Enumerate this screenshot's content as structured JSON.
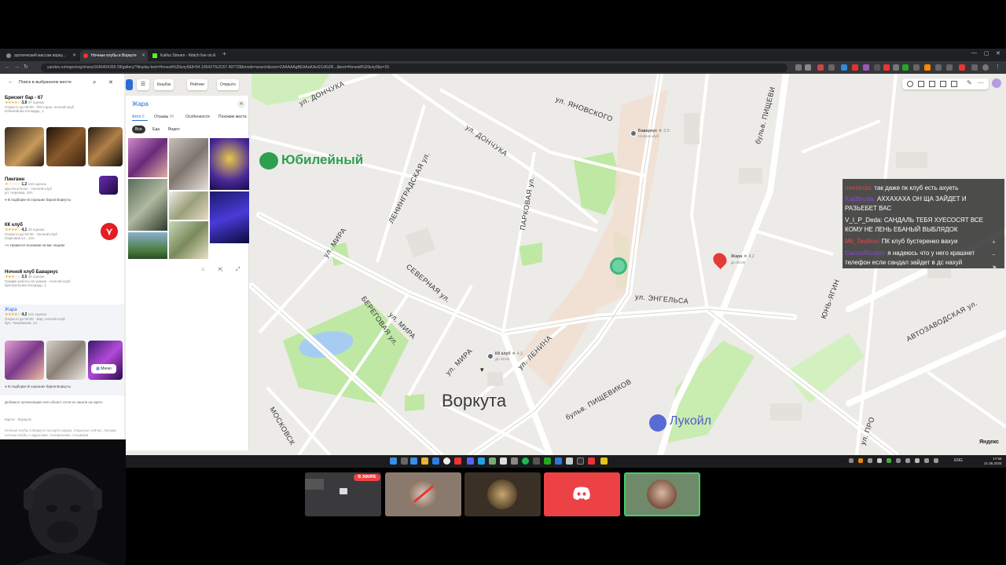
{
  "browser": {
    "tabs": [
      {
        "label": "эротический массаж ворку...",
        "color": "#8a8a8a"
      },
      {
        "label": "Ночные клубы в Воркуте",
        "color": "#e33"
      },
      {
        "label": "Kaifus Stream - Watch live on...",
        "color": "#53fc18"
      }
    ],
    "new_tab": "+",
    "url": "yandex.ru/maps/org/zhara/1646404359 28/gallery/?display-text=Ночной%20клуб&ll=54.105427%2C67.497728&mode=search&sctx=ZAAAAAgBEAAaKAoSCdGZR...&text=Ночной%20клуб&z=15"
  },
  "sidebar": {
    "search_placeholder": "Поиск в выбранном месте",
    "items": [
      {
        "title": "Брискет бар - 67",
        "rating": "3,8",
        "reviews": "37 оценок",
        "sub1": "Открыто до 00:00 · Ресторан, ночной клуб",
        "sub2": "Юбилейная площадь, 1"
      },
      {
        "title": "Пингвин",
        "rating": "1,2",
        "reviews": "116 оценок",
        "sub1": "круглосуточно · Ночной клуб",
        "sub2": "ул. Чернова, 10А",
        "tag": "В подборке В хороших баров Воркуты"
      },
      {
        "title": "КК клуб",
        "rating": "4,1",
        "reviews": "40 оценок",
        "sub1": "Открыто до 02:00 · Ночной клуб",
        "sub2": "Парковая ул., 14А",
        "tag": "Нравится похожим на вас людям"
      },
      {
        "title": "Ночной клуб Баварнус",
        "rating": "3,5",
        "reviews": "40 оценок",
        "sub1": "График работы не указан · Ночной клуб",
        "sub2": "Центральная площадь, 1"
      },
      {
        "title": "Жара",
        "rating": "4,2",
        "reviews": "121 оценок",
        "sub1": "Открыто до 00:00 · Бар, ночной клуб",
        "sub2": "бул. Пищевиков, 14",
        "tag": "В подборке В хороших баров Воркуты",
        "menu": "Меню"
      }
    ],
    "footer_text": "Добавьте организацию или объект, если их нашли на карте.",
    "footer_links": "Карты · Воркута",
    "footer_desc": "Ночные клубы в Воркуте на карте рядом, открытые сейчас. Лучшие ночные клубы с адресами, телефонами, отзывами"
  },
  "filters": {
    "f1": "Кешбэк",
    "f2": "Рейтинг",
    "f3": "Открыто"
  },
  "detail": {
    "title": "Жара",
    "tabs": [
      {
        "label": "Фото",
        "count": "8"
      },
      {
        "label": "Отзывы",
        "count": "96"
      },
      {
        "label": "Особенности",
        "count": ""
      },
      {
        "label": "Похожие места",
        "count": ""
      }
    ],
    "chips": [
      "Все",
      "Еда",
      "Видео"
    ]
  },
  "map": {
    "labels": {
      "donchuka1": "ул. ДОНЧУКА",
      "donchuka2": "ул. ДОНЧУКА",
      "yanovskogo": "ул. ЯНОВСКОГО",
      "pishevikov_top": "бульв. ПИЩЕВИ",
      "leningradskaya": "ЛЕНИНГРАДСКАЯ ул.",
      "parkovaya": "ПАРКОВАЯ ул.",
      "mira1": "ул. МИРА",
      "severnaya": "СЕВЕРНАЯ ул.",
      "beregovaya": "БЕРЕГОВАЯ ул.",
      "mira2": "ул. МИРА",
      "mira3": "ул. МИРА",
      "lenina": "ул. ЛЕНИНА",
      "engelsa": "ул. ЭНГЕЛЬСА",
      "pishevikov": "бульв. ПИЩЕВИКОВ",
      "avtozavodskaya": "АВТОЗАВОДСКАЯ ул.",
      "yunyagin": "ЮНЬ-ЯГИН",
      "moskovsk": "МОСКОВСК",
      "upro": "ул. ПРО",
      "vorkuta": "Воркута",
      "yubileyny": "Юбилейный",
      "lukoil": "Лукойл",
      "yandex": "Яндекс"
    },
    "pois": {
      "bavarus": {
        "name": "Баварнус",
        "rating": "★ 3,5",
        "sub": "Ночной клуб"
      },
      "zhara": {
        "name": "Жара",
        "rating": "★ 4,2",
        "sub": "До 00:00"
      },
      "kk": {
        "name": "КК клуб",
        "rating": "★ 4,1",
        "sub": "До 02:00"
      }
    }
  },
  "chat": {
    "messages": [
      {
        "user": "",
        "text": "",
        "color": "#9a9a9a"
      },
      {
        "user": "neelanda:",
        "text": "так даже пк клуб есть ахуеть",
        "color": "#c34b4b"
      },
      {
        "user": "Kajdbruda:",
        "text": "АХХАХАХА ОН ЩА ЗАЙДЕТ И",
        "color": "#8a4bd8"
      },
      {
        "user": "",
        "text": "РАЗЬЕБЕТ ВАС",
        "color": ""
      },
      {
        "user": "V_I_P_Deda:",
        "text": "САНДАЛЬ ТЕБЯ ХУЕСОСЯТ ВСЕ",
        "color": "#ffffff"
      },
      {
        "user": "",
        "text": "КОМУ НЕ ЛЕНЬ ЕБАНЫЙ ВЫБЛЯДОК",
        "color": ""
      },
      {
        "user": "Mk_Teufilov:",
        "text": "ПК клуб бустеренко вахуи",
        "color": "#e04a4a"
      },
      {
        "user": "CactusRodzin:",
        "text": "я надеюсь что у него крашнет",
        "color": "#8a4bd8"
      },
      {
        "user": "",
        "text": "телефон если сандал зайдет в дс нахуй",
        "color": ""
      }
    ]
  },
  "taskbar": {
    "lang": "ENG",
    "time": "17:56",
    "date": "21.08.2025"
  },
  "tiles": {
    "live_badge": "В ЭФИРЕ"
  },
  "colors": {
    "map_bg": "#ecebe7",
    "park": "#bfe8a4",
    "water": "#a6cdf1",
    "road": "#ffffff",
    "accent_red": "#e33a3a",
    "discord": "#ed4245"
  }
}
